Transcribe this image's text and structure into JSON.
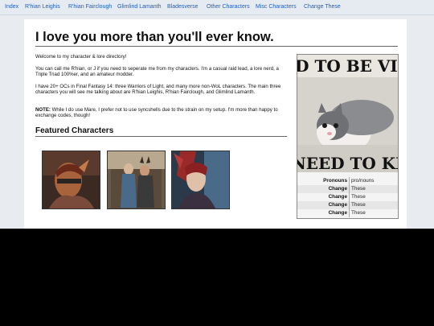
{
  "nav": [
    {
      "label": "Index"
    },
    {
      "label": "R'hian Leighis"
    },
    {
      "label": "R'hian Fairclough"
    },
    {
      "label": "Glimlind Lamanth"
    },
    {
      "label": "Bladesverse"
    },
    {
      "label": "Other Characters"
    },
    {
      "label": "Misc Characters"
    },
    {
      "label": "Change These"
    }
  ],
  "main": {
    "title": "I love you more than you'll ever know.",
    "p1": "Welcome to my character & lore directory!",
    "p2": "You can call me R'hian, or J if you need to seperate me from my characters. I'm a casual raid lead, a lore nerd, a Triple Triad 100%er, and an amateur modder.",
    "p3": "I have 20+ OCs in Final Fantasy 14: three Warriors of Light, and many more non-WoL characters. The main three characters you will see me talking about are R'hian Leighis, R'hian Fairclough, and Glimlind Lamanth.",
    "note_label": "NOTE:",
    "note_text": " While I do use Mare, I prefer not to use syncshells due to the strain on my setup. I'm more than happy to exchange codes, though!",
    "featured_heading": "Featured Characters"
  },
  "sidebar": {
    "poster_top": "ED TO BE VIO",
    "poster_bottom": "NEED TO KI",
    "rows": [
      {
        "k": "Pronouns",
        "v": "pro/nouns"
      },
      {
        "k": "Change",
        "v": "These"
      },
      {
        "k": "Change",
        "v": "These"
      },
      {
        "k": "Change",
        "v": "These"
      },
      {
        "k": "Change",
        "v": "These"
      }
    ]
  }
}
